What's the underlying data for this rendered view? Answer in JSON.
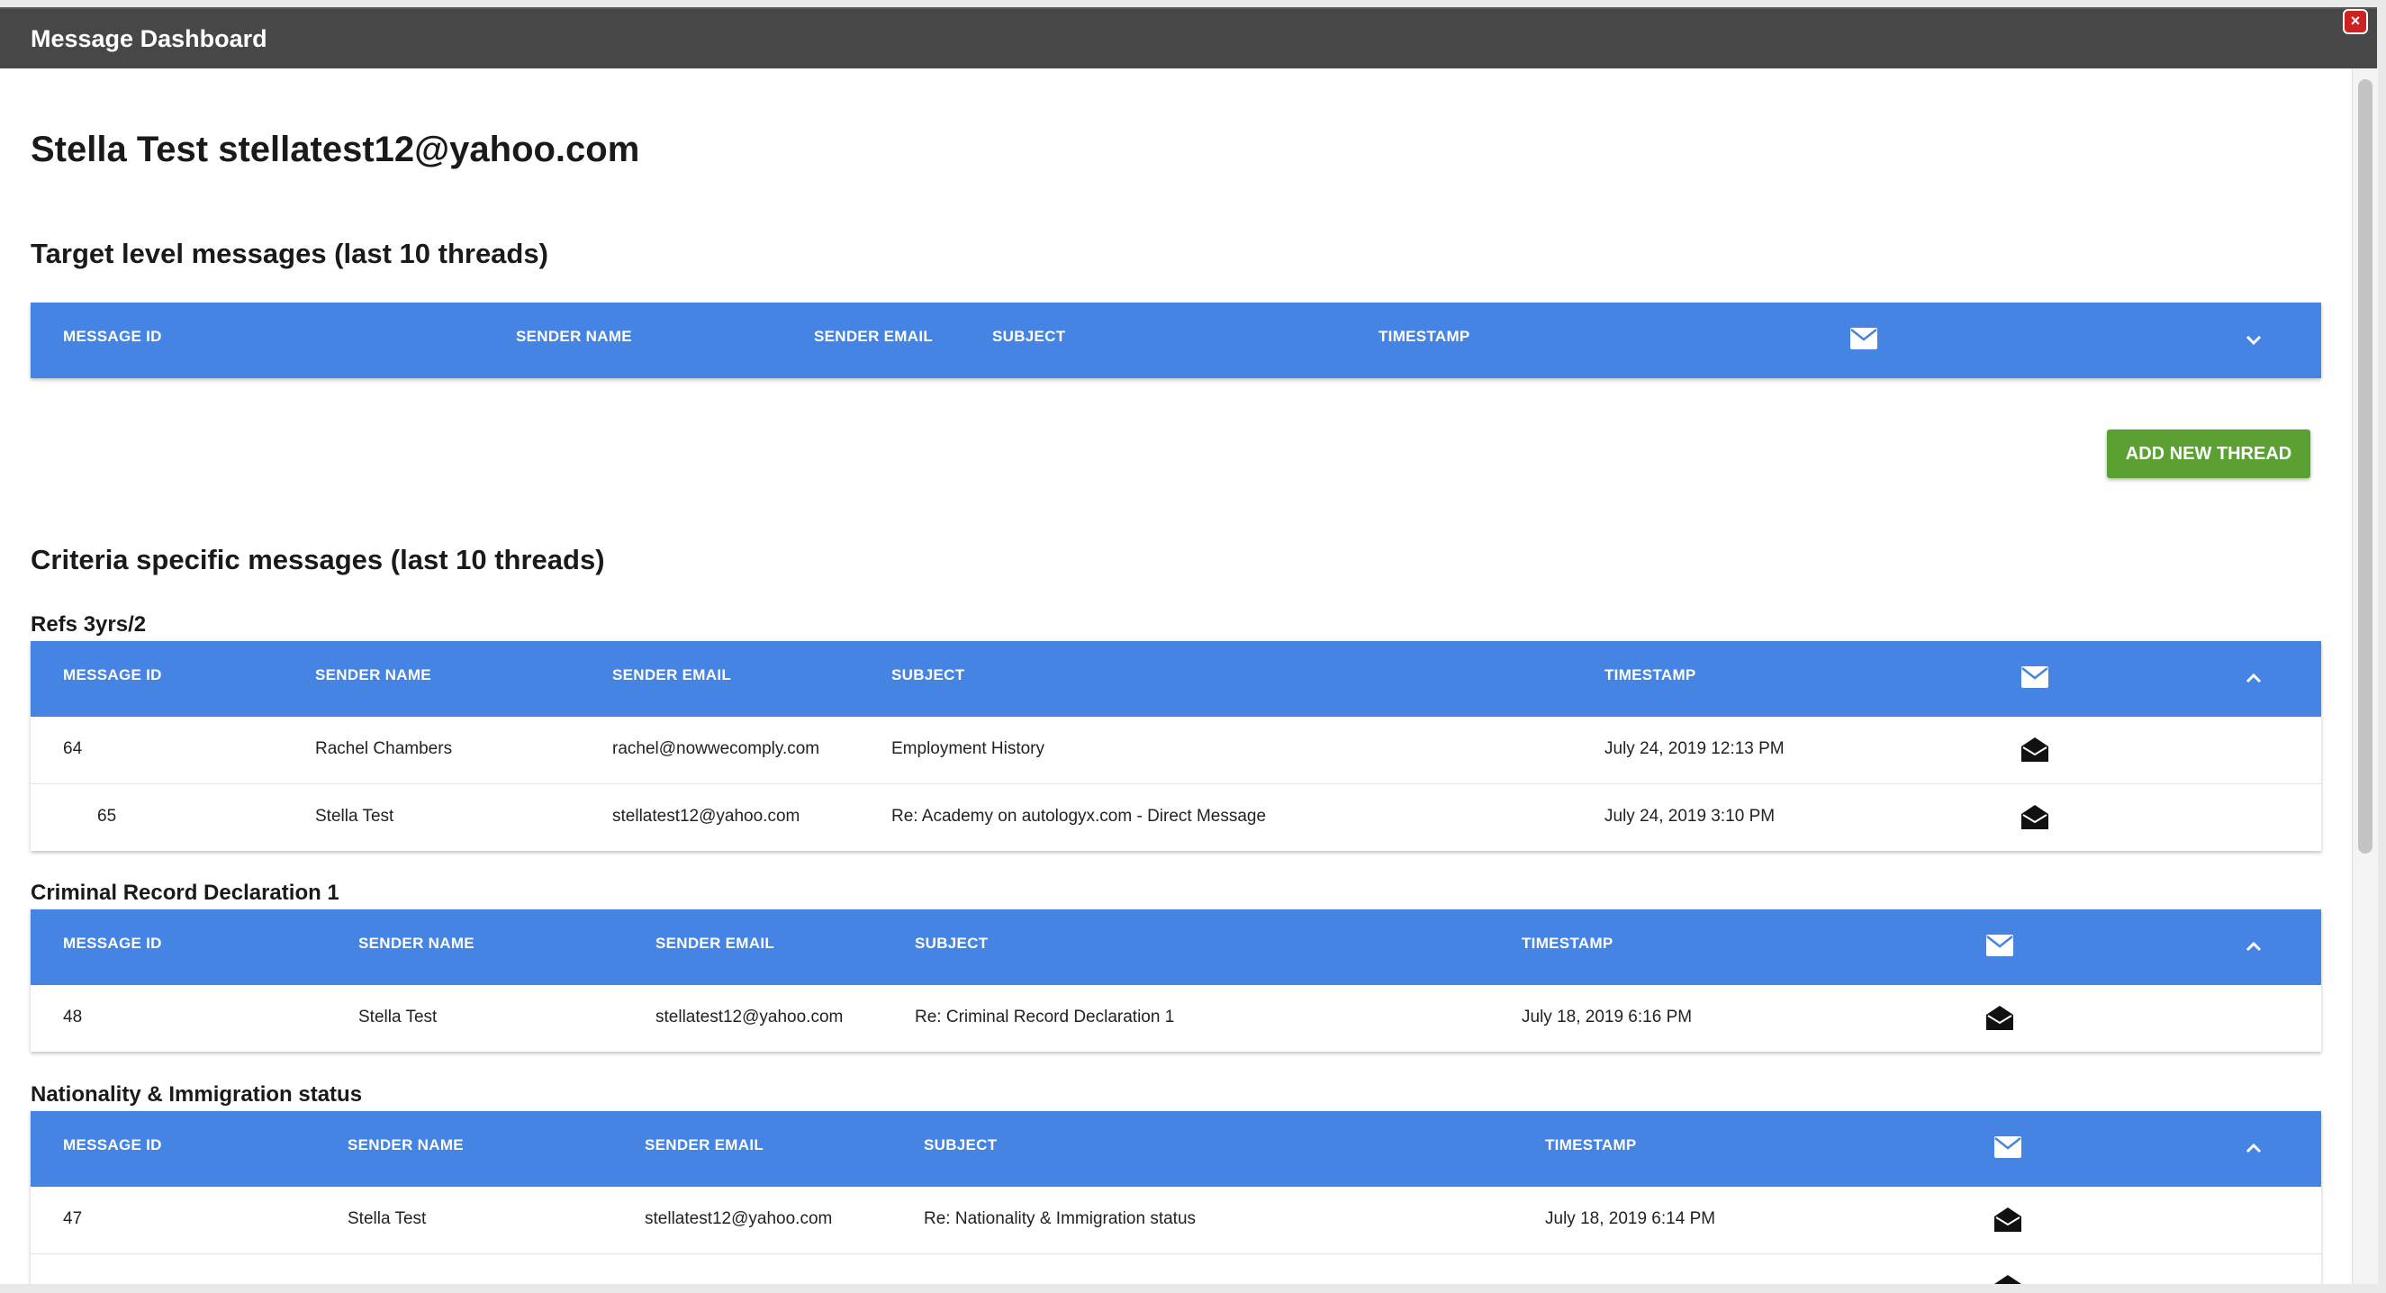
{
  "window": {
    "title": "Message Dashboard",
    "close_label": "×"
  },
  "page_title": "Stella Test stellatest12@yahoo.com",
  "target": {
    "title": "Target level messages (last 10 threads)",
    "headers": [
      "MESSAGE ID",
      "SENDER NAME",
      "SENDER EMAIL",
      "SUBJECT",
      "TIMESTAMP"
    ]
  },
  "add_thread_label": "ADD NEW THREAD",
  "criteria": {
    "title": "Criteria specific messages (last 10 threads)",
    "groups": [
      {
        "name": "Refs 3yrs/2",
        "headers": [
          "MESSAGE ID",
          "SENDER NAME",
          "SENDER EMAIL",
          "SUBJECT",
          "TIMESTAMP"
        ],
        "rows": [
          [
            "64",
            "Rachel Chambers",
            "rachel@nowwecomply.com",
            "Employment History",
            "July 24, 2019 12:13 PM"
          ],
          [
            "65",
            "Stella Test",
            "stellatest12@yahoo.com",
            "Re: Academy on autologyx.com - Direct Message",
            "July 24, 2019 3:10 PM"
          ]
        ]
      },
      {
        "name": "Criminal Record Declaration 1",
        "headers": [
          "MESSAGE ID",
          "SENDER NAME",
          "SENDER EMAIL",
          "SUBJECT",
          "TIMESTAMP"
        ],
        "rows": [
          [
            "48",
            "Stella Test",
            "stellatest12@yahoo.com",
            "Re: Criminal Record Declaration 1",
            "July 18, 2019 6:16 PM"
          ]
        ]
      },
      {
        "name": "Nationality & Immigration status",
        "headers": [
          "MESSAGE ID",
          "SENDER NAME",
          "SENDER EMAIL",
          "SUBJECT",
          "TIMESTAMP"
        ],
        "rows": [
          [
            "47",
            "Stella Test",
            "stellatest12@yahoo.com",
            "Re: Nationality & Immigration status",
            "July 18, 2019 6:14 PM"
          ]
        ]
      }
    ]
  },
  "colors": {
    "header_blue": "#4584e3",
    "add_button_green": "#5aa132",
    "titlebar": "#474747"
  },
  "icons": {
    "header_mail": "envelope-closed-icon",
    "row_mail": "envelope-open-icon",
    "collapse": "chevron-up-icon",
    "expand": "chevron-down-icon",
    "close": "close-icon"
  }
}
